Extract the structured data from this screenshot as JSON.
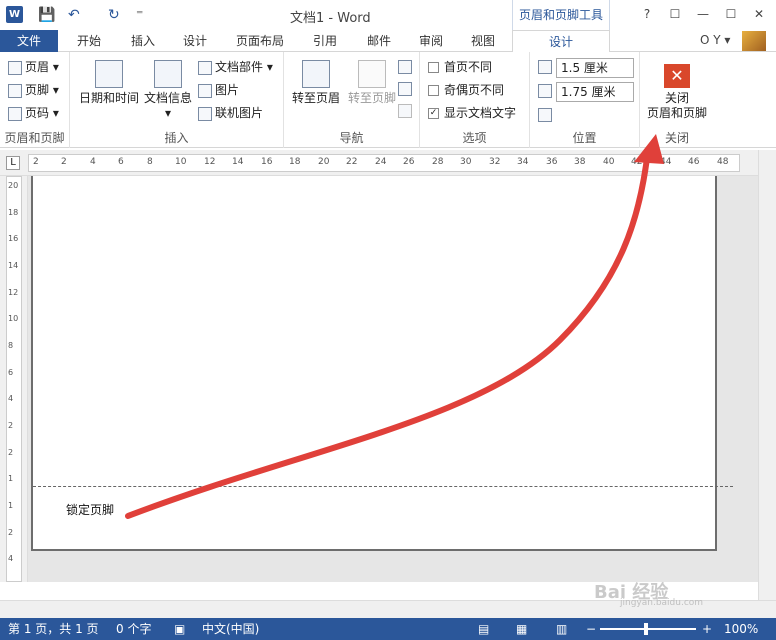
{
  "titlebar": {
    "app_icon": "W",
    "doc_title": "文档1 - Word",
    "context_tab_header": "页眉和页脚工具",
    "win_help": "?",
    "win_min": "—",
    "win_max": "☐",
    "win_close": "✕",
    "save_icon": "💾",
    "undo_icon": "↶",
    "redo_icon": "↻",
    "qat_more": "⁼"
  },
  "tabs": {
    "file": "文件",
    "home": "开始",
    "insert": "插入",
    "design_main": "设计",
    "layout": "页面布局",
    "references": "引用",
    "mailings": "邮件",
    "review": "审阅",
    "view": "视图",
    "design_context": "设计",
    "account": "O Y ▾"
  },
  "ribbon": {
    "hf_group": {
      "header": "页眉 ▾",
      "footer": "页脚 ▾",
      "page_number": "页码 ▾",
      "label": "页眉和页脚"
    },
    "insert_group": {
      "datetime": "日期和时间",
      "docinfo": "文档信息",
      "docinfo_arrow": "▾",
      "quick_parts": "文档部件 ▾",
      "pictures": "图片",
      "online_pictures": "联机图片",
      "label": "插入"
    },
    "nav_group": {
      "goto_header": "转至页眉",
      "goto_footer": "转至页脚",
      "label": "导航"
    },
    "options_group": {
      "diff_first": "首页不同",
      "diff_odd_even": "奇偶页不同",
      "show_doc_text": "显示文档文字",
      "show_doc_text_check": "✓",
      "label": "选项"
    },
    "position_group": {
      "header_pos": "1.5 厘米",
      "footer_pos": "1.75 厘米",
      "label": "位置"
    },
    "close_group": {
      "close_icon_glyph": "✕",
      "close_line1": "关闭",
      "close_line2": "页眉和页脚",
      "label": "关闭"
    }
  },
  "ruler": {
    "corner": "L",
    "ticks": [
      "2",
      "2",
      "4",
      "6",
      "8",
      "10",
      "12",
      "14",
      "16",
      "18",
      "20",
      "22",
      "24",
      "26",
      "28",
      "30",
      "32",
      "34",
      "36",
      "38",
      "40",
      "42",
      "44",
      "46",
      "48"
    ]
  },
  "vruler": {
    "ticks": [
      "20",
      "18",
      "16",
      "14",
      "12",
      "10",
      "8",
      "6",
      "4",
      "2",
      "2",
      "1",
      "1",
      "2",
      "4"
    ]
  },
  "document": {
    "footer_text": "锁定页脚"
  },
  "status": {
    "page": "第 1 页，共 1 页",
    "words": "0 个字",
    "language": "中文(中国)",
    "zoom": "100%",
    "zoom_minus": "−",
    "zoom_plus": "+"
  },
  "watermark": {
    "text": "Bai 经验",
    "url": "jingyan.baidu.com"
  },
  "colors": {
    "accent": "#2b579a",
    "arrow": "#e0403a"
  }
}
